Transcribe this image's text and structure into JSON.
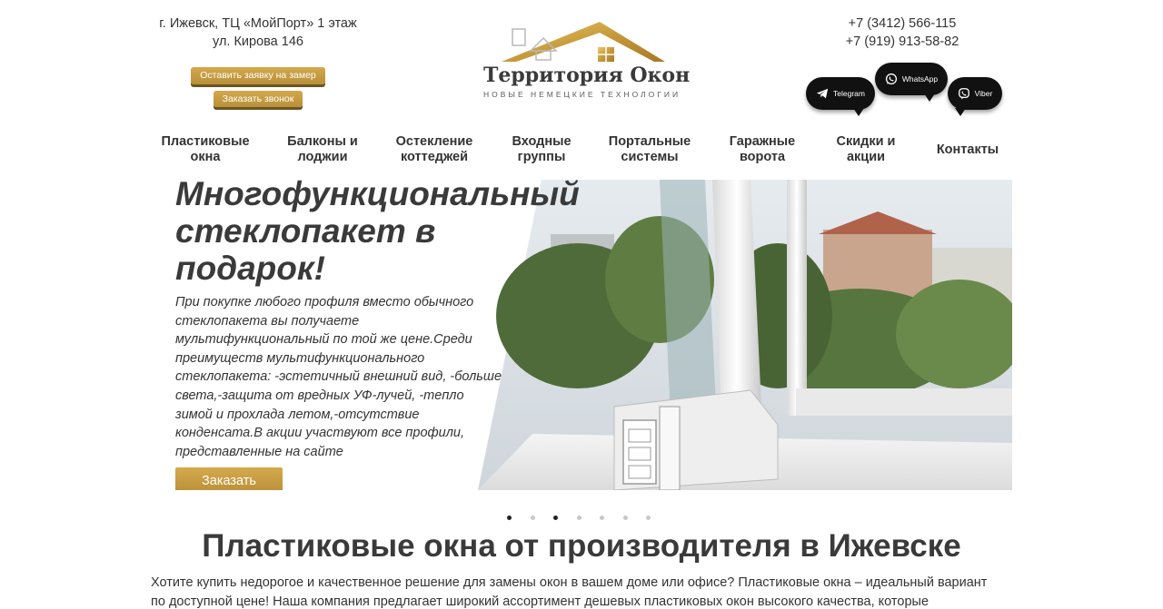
{
  "header": {
    "address_line1": "г. Ижевск, ТЦ «МойПорт» 1 этаж",
    "address_line2": "ул. Кирова 146",
    "measure_button": "Оставить заявку на замер",
    "call_button": "Заказать звонок",
    "logo_title": "Территория Окон",
    "logo_subtitle": "НОВЫЕ НЕМЕЦКИЕ ТЕХНОЛОГИИ",
    "phone1": "+7 (3412) 566-115",
    "phone2": "+7 (919) 913-58-82",
    "messengers": {
      "telegram": "Telegram",
      "whatsapp": "WhatsApp",
      "viber": "Viber"
    }
  },
  "nav": {
    "items": [
      {
        "line1": "Пластиковые",
        "line2": "окна"
      },
      {
        "line1": "Балконы и",
        "line2": "лоджии"
      },
      {
        "line1": "Остекление",
        "line2": "коттеджей"
      },
      {
        "line1": "Входные",
        "line2": "группы"
      },
      {
        "line1": "Портальные",
        "line2": "системы"
      },
      {
        "line1": "Гаражные",
        "line2": "ворота"
      },
      {
        "line1": "Скидки и",
        "line2": "акции"
      },
      {
        "line1": "Контакты",
        "line2": ""
      }
    ]
  },
  "hero": {
    "title_line1": "Многофункциональный",
    "title_line2": "стеклопакет в",
    "title_line3": "подарок!",
    "text": "При покупке любого профиля вместо обычного стеклопакета вы получаете мультифункциональный по той же цене.Среди преимуществ мультифункционального стеклопакета: -эстетичный внешний вид, -больше света,-защита от вредных УФ-лучей, -тепло зимой и прохлада летом,-отсутствие конденсата.В акции участвуют все профили, представленные на сайте",
    "button": "Заказать",
    "slides_total": 7,
    "active_slides": [
      0,
      2
    ]
  },
  "section": {
    "title": "Пластиковые окна от производителя в Ижевске",
    "text": "Хотите купить недорогое и качественное решение для замены окон в вашем доме или офисе? Пластиковые окна – идеальный вариант по доступной цене! Наша компания предлагает широкий ассортимент дешевых пластиковых окон высокого качества, которые обеспечивают"
  },
  "colors": {
    "gold": "#c9a045",
    "text": "#333333",
    "bubble": "#111111"
  }
}
